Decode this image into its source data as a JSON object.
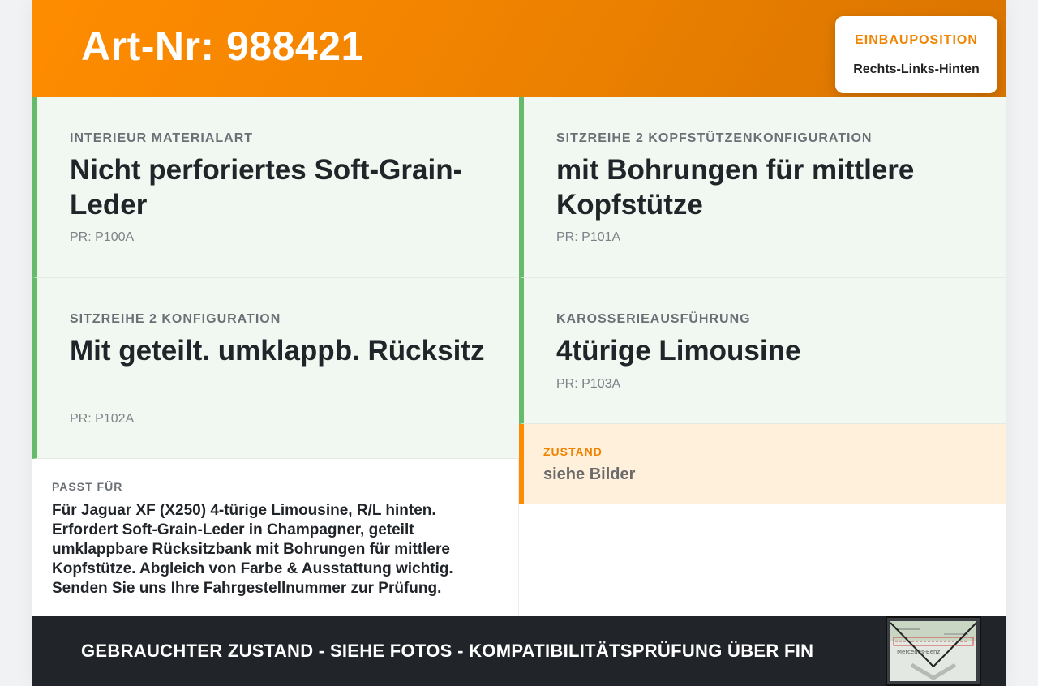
{
  "header": {
    "art_nr": "Art-Nr: 988421",
    "position_label": "EINBAUPOSITION",
    "position_value": "Rechts-Links-Hinten"
  },
  "cells": [
    {
      "label": "INTERIEUR MATERIALART",
      "value": "Nicht perforiertes Soft-Grain-Leder",
      "pr": "PR: P100A"
    },
    {
      "label": "SITZREIHE 2 KOPFSTÜTZENKONFIGURATION",
      "value": "mit Bohrungen für mittlere Kopfstütze",
      "pr": "PR: P101A"
    },
    {
      "label": "SITZREIHE 2 KONFIGURATION",
      "value": "Mit geteilt. umklappb. Rücksitz",
      "pr": "PR: P102A"
    },
    {
      "label": "KAROSSERIEAUSFÜHRUNG",
      "value": "4türige Limousine",
      "pr": "PR: P103A"
    }
  ],
  "passt": {
    "label": "PASST FÜR",
    "text": "Für Jaguar XF (X250) 4-türige Limousine, R/L hinten. Erfordert Soft-Grain-Leder in Champagner, geteilt umklappbare Rücksitzbank mit Bohrungen für mittlere Kopfstütze. Abgleich von Farbe & Ausstattung wichtig. Senden Sie uns Ihre Fahrgestellnummer zur Prüfung."
  },
  "zustand": {
    "label": "ZUSTAND",
    "value": "siehe Bilder"
  },
  "footer": {
    "text": "GEBRAUCHTER ZUSTAND - SIEHE FOTOS - KOMPATIBILITÄTSPRÜFUNG ÜBER FIN",
    "thumbnail_label_text": "Mercedes-Benz"
  },
  "colors": {
    "accent_orange": "#ff8c00",
    "accent_green": "#66bb6a",
    "dark": "#212529"
  }
}
